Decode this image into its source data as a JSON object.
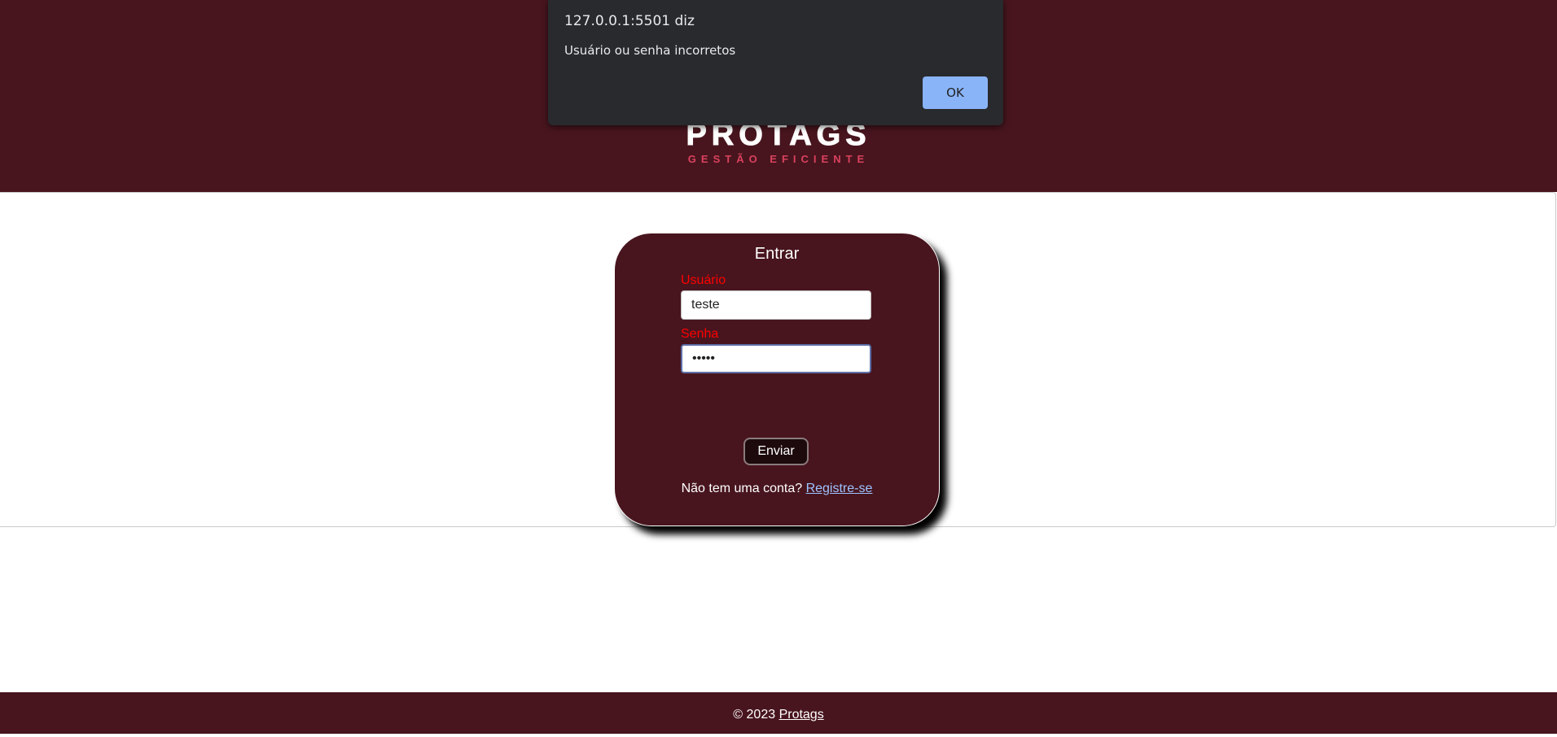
{
  "header": {
    "logo_word": "PROTAGS",
    "logo_tagline": "GESTÃO EFICIENTE",
    "background_color": "#48151e"
  },
  "login": {
    "title": "Entrar",
    "username_label": "Usuário",
    "username_value": "teste",
    "password_label": "Senha",
    "password_value": "•••••",
    "submit_label": "Enviar",
    "signup_prompt": "Não tem uma conta?",
    "signup_link": "Registre-se"
  },
  "footer": {
    "copyright": "© 2023",
    "brand_link": "Protags"
  },
  "alert_dialog": {
    "title": "127.0.0.1:5501 diz",
    "message": "Usuário ou senha incorretos",
    "ok_label": "OK"
  },
  "colors": {
    "brand_maroon": "#48151e",
    "label_red": "#ff0000",
    "link_blue": "#9ec3ff",
    "dialog_bg": "#292a2d",
    "dialog_button": "#8ab4f8"
  }
}
